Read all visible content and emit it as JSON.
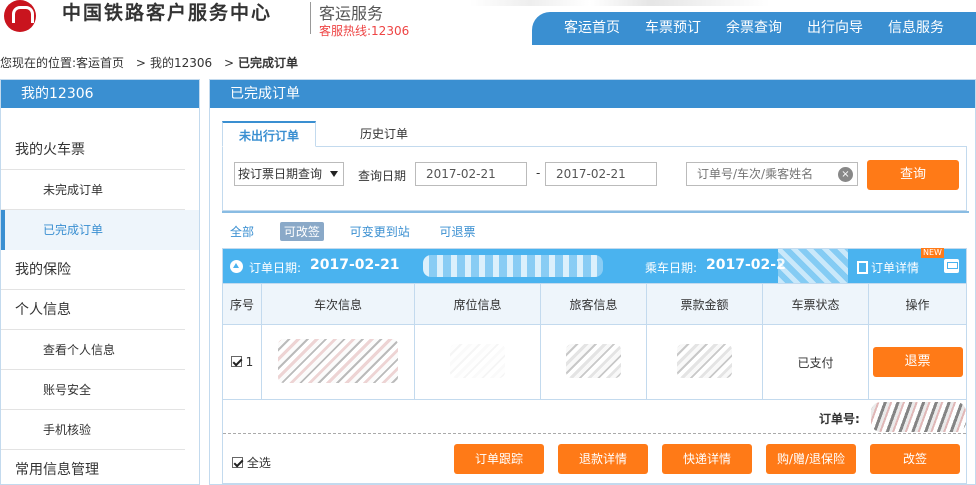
{
  "header": {
    "site_title": "中国铁路客户服务中心",
    "site_subtitle": "客运服务",
    "hotline": "客服热线:12306",
    "nav": [
      "客运首页",
      "车票预订",
      "余票查询",
      "出行向导",
      "信息服务"
    ]
  },
  "breadcrumb": {
    "prefix": "您现在的位置:",
    "items": [
      "客运首页",
      "我的12306"
    ],
    "separator": ">",
    "current": "已完成订单"
  },
  "sidebar": {
    "title": "我的12306",
    "items": [
      {
        "label": "我的火车票",
        "type": "group"
      },
      {
        "label": "未完成订单",
        "type": "sub"
      },
      {
        "label": "已完成订单",
        "type": "sub",
        "active": true
      },
      {
        "label": "我的保险",
        "type": "group"
      },
      {
        "label": "个人信息",
        "type": "group"
      },
      {
        "label": "查看个人信息",
        "type": "sub"
      },
      {
        "label": "账号安全",
        "type": "sub"
      },
      {
        "label": "手机核验",
        "type": "sub"
      },
      {
        "label": "常用信息管理",
        "type": "group"
      }
    ]
  },
  "main": {
    "title": "已完成订单",
    "tabs": [
      "未出行订单",
      "历史订单"
    ],
    "search": {
      "mode_selected": "按订票日期查询",
      "date_label": "查询日期",
      "date_from": "2017-02-21",
      "date_sep": "-",
      "date_to": "2017-02-21",
      "keyword_placeholder": "订单号/车次/乘客姓名",
      "clear_icon": "×",
      "query_button": "查询"
    },
    "filters": [
      "全部",
      "可改签",
      "可变更到站",
      "可退票"
    ],
    "active_filter": "可改签",
    "order": {
      "order_date_label": "订单日期:",
      "order_date": "2017-02-21",
      "ride_date_label": "乘车日期:",
      "ride_date": "2017-02-2",
      "detail_link": "订单详情",
      "new_badge": "NEW",
      "columns": [
        "序号",
        "车次信息",
        "席位信息",
        "旅客信息",
        "票款金额",
        "车票状态",
        "操作"
      ],
      "rows": [
        {
          "index": "1",
          "status": "已支付",
          "action": "退票"
        }
      ],
      "order_no_label": "订单号:",
      "select_all": "全选",
      "actions": [
        "订单跟踪",
        "退款详情",
        "快递详情",
        "购/赠/退保险",
        "改签"
      ]
    }
  },
  "colors": {
    "primary_blue": "#3a8fd1",
    "order_header_blue": "#4ab3ef",
    "action_orange": "#ff7a17",
    "logo_red": "#c9141e"
  }
}
